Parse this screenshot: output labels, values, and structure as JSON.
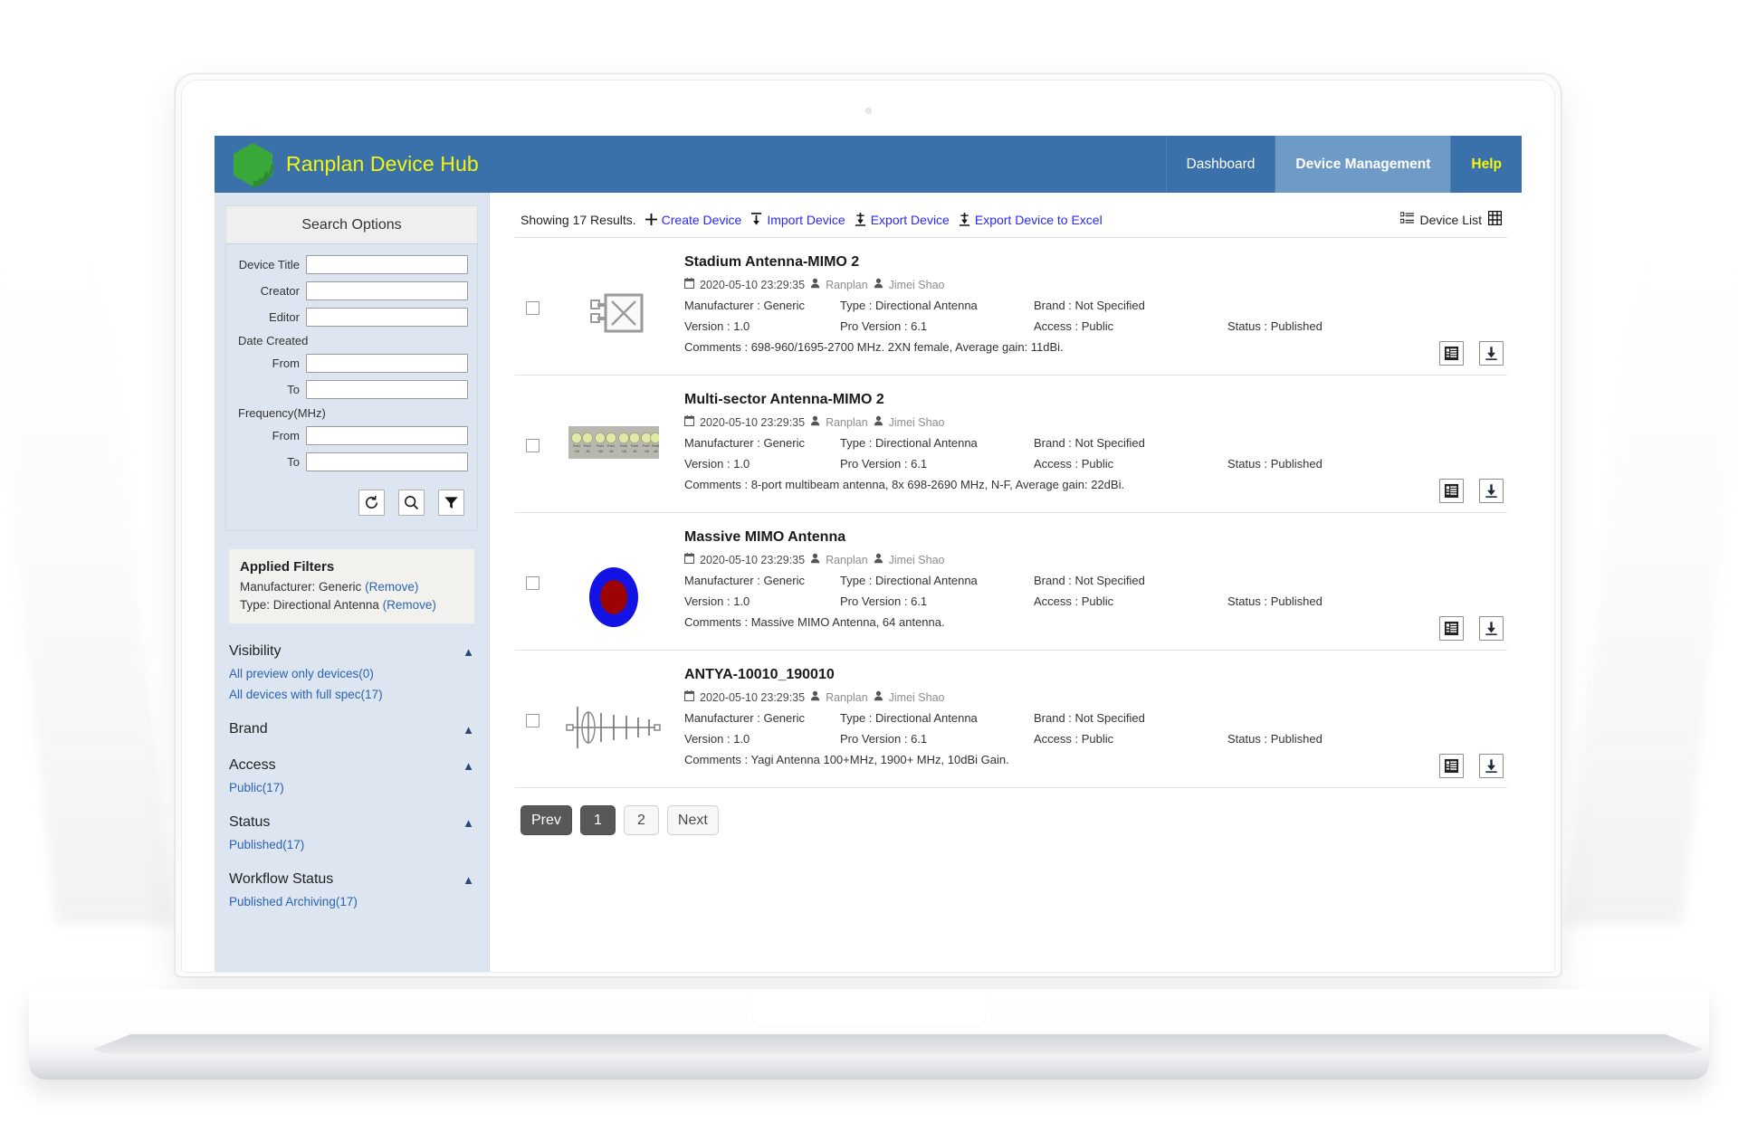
{
  "app": {
    "brand_title": "Ranplan Device Hub",
    "logo_icon": "ranplan-hexagon-wifi-logo",
    "nav": [
      {
        "label": "Dashboard",
        "active": false,
        "highlight": false
      },
      {
        "label": "Device Management",
        "active": true,
        "highlight": false
      },
      {
        "label": "Help",
        "active": false,
        "highlight": true
      }
    ],
    "accent_blue": "#3a71ab",
    "accent_active_blue": "#6e9bc6",
    "accent_yellow": "#f6f60a",
    "link_blue": "#2a2af0",
    "sidebar_bg": "#dde5f0"
  },
  "sidebar": {
    "panel_title": "Search Options",
    "fields": [
      {
        "label": "Device Title",
        "value": "",
        "placeholder": ""
      },
      {
        "label": "Creator",
        "value": "",
        "placeholder": ""
      },
      {
        "label": "Editor",
        "value": "",
        "placeholder": ""
      }
    ],
    "date_created": {
      "group_label": "Date Created",
      "from_label": "From",
      "from_value": "",
      "to_label": "To",
      "to_value": ""
    },
    "frequency": {
      "group_label": "Frequency(MHz)",
      "from_label": "From",
      "from_value": "",
      "to_label": "To",
      "to_value": ""
    },
    "actions": [
      {
        "name": "reset-icon",
        "title": "Reset"
      },
      {
        "name": "search-icon",
        "title": "Search"
      },
      {
        "name": "filter-icon",
        "title": "Filter"
      }
    ],
    "applied_filters": {
      "title": "Applied Filters",
      "items": [
        {
          "text": "Manufacturer: Generic",
          "remove_label": "(Remove)"
        },
        {
          "text": "Type: Directional Antenna",
          "remove_label": "(Remove)"
        }
      ]
    },
    "facets": [
      {
        "title": "Visibility",
        "caret": "collapse-caret-icon",
        "links": [
          "All preview only devices(0)",
          "All devices with full spec(17)"
        ]
      },
      {
        "title": "Brand",
        "caret": "collapse-caret-icon",
        "links": []
      },
      {
        "title": "Access",
        "caret": "collapse-caret-icon",
        "links": [
          "Public(17)"
        ]
      },
      {
        "title": "Status",
        "caret": "collapse-caret-icon",
        "links": [
          "Published(17)"
        ]
      },
      {
        "title": "Workflow Status",
        "caret": "collapse-caret-icon",
        "links": [
          "Published Archiving(17)"
        ]
      }
    ]
  },
  "main": {
    "results_count_text": "Showing 17 Results.",
    "toolbar_links": [
      {
        "label": "Create Device",
        "icon": "plus-icon"
      },
      {
        "label": "Import Device",
        "icon": "import-arrow-icon"
      },
      {
        "label": "Export Device",
        "icon": "export-arrow-icon"
      },
      {
        "label": "Export Device to Excel",
        "icon": "export-arrow-icon"
      }
    ],
    "view_toggle": {
      "list_icon": "list-view-icon",
      "label": "Device List",
      "grid_icon": "grid-view-icon"
    },
    "labels": {
      "manufacturer": "Manufacturer :",
      "type": "Type :",
      "brand": "Brand :",
      "version": "Version :",
      "pro_version": "Pro Version :",
      "access": "Access :",
      "status": "Status :",
      "comments": "Comments :"
    },
    "devices": [
      {
        "title": "Stadium Antenna-MIMO 2",
        "date": "2020-05-10 23:29:35",
        "creator": "Ranplan",
        "editor": "Jimei Shao",
        "manufacturer": "Generic",
        "type": "Directional Antenna",
        "brand": "Not Specified",
        "version": "1.0",
        "pro_version": "6.1",
        "access": "Public",
        "status": "Published",
        "comments": "698-960/1695-2700 MHz. 2XN female, Average gain: 11dBi.",
        "thumb": "stadium-antenna-box-x-thumbnail"
      },
      {
        "title": "Multi-sector Antenna-MIMO 2",
        "date": "2020-05-10 23:29:35",
        "creator": "Ranplan",
        "editor": "Jimei Shao",
        "manufacturer": "Generic",
        "type": "Directional Antenna",
        "brand": "Not Specified",
        "version": "1.0",
        "pro_version": "6.1",
        "access": "Public",
        "status": "Published",
        "comments": "8-port multibeam antenna, 8x 698-2690 MHz, N-F, Average gain: 22dBi.",
        "thumb": "multisector-8port-panel-thumbnail"
      },
      {
        "title": "Massive MIMO Antenna",
        "date": "2020-05-10 23:29:35",
        "creator": "Ranplan",
        "editor": "Jimei Shao",
        "manufacturer": "Generic",
        "type": "Directional Antenna",
        "brand": "Not Specified",
        "version": "1.0",
        "pro_version": "6.1",
        "access": "Public",
        "status": "Published",
        "comments": "Massive MIMO Antenna, 64 antenna.",
        "thumb": "massive-mimo-ellipse-thumbnail"
      },
      {
        "title": "ANTYA-10010_190010",
        "date": "2020-05-10 23:29:35",
        "creator": "Ranplan",
        "editor": "Jimei Shao",
        "manufacturer": "Generic",
        "type": "Directional Antenna",
        "brand": "Not Specified",
        "version": "1.0",
        "pro_version": "6.1",
        "access": "Public",
        "status": "Published",
        "comments": "Yagi Antenna 100+MHz, 1900+ MHz, 10dBi Gain.",
        "thumb": "yagi-antenna-thumbnail"
      }
    ],
    "row_actions": [
      {
        "name": "device-details-icon",
        "title": "Details"
      },
      {
        "name": "download-icon",
        "title": "Download"
      }
    ],
    "pagination": [
      {
        "label": "Prev",
        "state": "dark"
      },
      {
        "label": "1",
        "state": "dark"
      },
      {
        "label": "2",
        "state": "light"
      },
      {
        "label": "Next",
        "state": "light"
      }
    ]
  }
}
